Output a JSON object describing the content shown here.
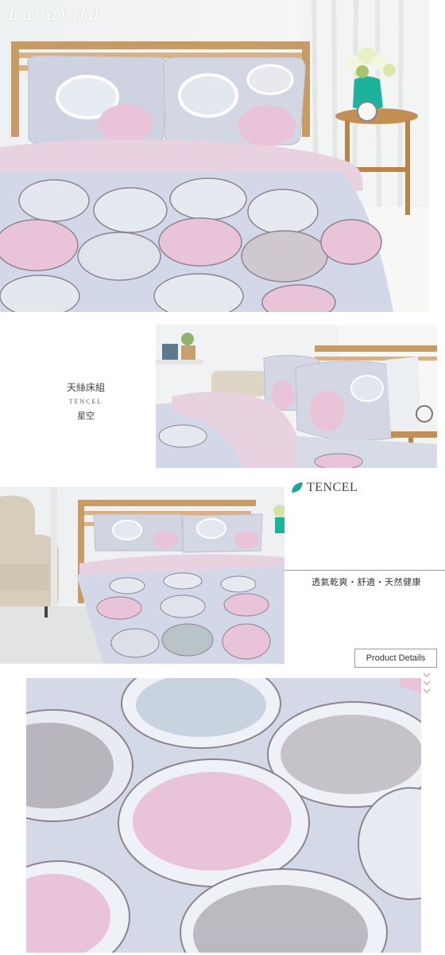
{
  "brand": {
    "logo_text": "LunaVita"
  },
  "product": {
    "name_zh": "天絲床組",
    "name_en": "TENCEL",
    "pattern": "星空"
  },
  "tencel_logo": {
    "text": "TENCEL",
    "accent_color": "#1ba39c"
  },
  "tagline": "透氣乾爽・舒適・天然健康",
  "details_button": {
    "label": "Product Details"
  },
  "icons": {
    "chevrons": "chevron-down-icon"
  },
  "colors": {
    "fabric_base": "#d3d9e6",
    "circle_pink": "#e9c3d8",
    "circle_grey": "#bfbcc4",
    "circle_outline": "#8c8590",
    "quilt_pink": "#e9d2e0",
    "wood": "#c89a64"
  }
}
